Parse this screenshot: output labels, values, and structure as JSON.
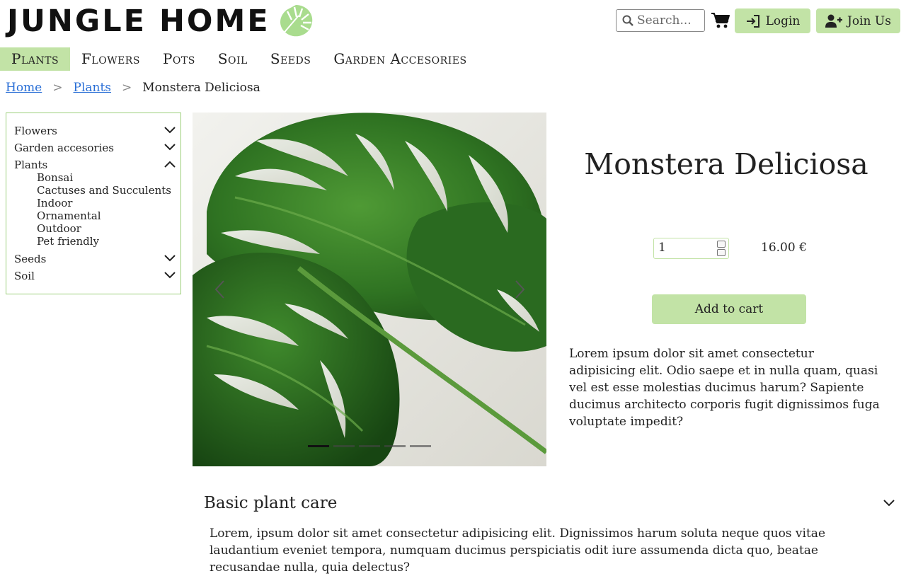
{
  "header": {
    "logo_text": "JUNGLE HOME",
    "search_placeholder": "Search...",
    "login_label": "Login",
    "join_label": "Join Us"
  },
  "nav": {
    "items": [
      "Plants",
      "Flowers",
      "Pots",
      "Soil",
      "Seeds",
      "Garden Accesories"
    ],
    "active": "Plants"
  },
  "breadcrumb": {
    "home": "Home",
    "plants": "Plants",
    "current": "Monstera Deliciosa",
    "separator": ">"
  },
  "sidebar": {
    "categories": [
      {
        "label": "Flowers",
        "expanded": false
      },
      {
        "label": "Garden accesories",
        "expanded": false
      },
      {
        "label": "Plants",
        "expanded": true,
        "children": [
          "Bonsai",
          "Cactuses and Succulents",
          "Indoor",
          "Ornamental",
          "Outdoor",
          "Pet friendly"
        ]
      },
      {
        "label": "Seeds",
        "expanded": false
      },
      {
        "label": "Soil",
        "expanded": false
      }
    ]
  },
  "gallery": {
    "slide_count": 5,
    "active_slide": 1
  },
  "product": {
    "title": "Monstera Deliciosa",
    "quantity": "1",
    "price": "16.00 €",
    "add_to_cart": "Add to cart",
    "description": "Lorem ipsum dolor sit amet consectetur adipisicing elit. Odio saepe et in nulla quam, quasi vel est esse molestias ducimus harum? Sapiente ducimus architecto corporis fugit dignissimos fuga voluptate impedit?"
  },
  "care": {
    "title": "Basic plant care",
    "text": "Lorem, ipsum dolor sit amet consectetur adipisicing elit. Dignissimos harum soluta neque quos vitae laudantium eveniet tempora, numquam ducimus perspiciatis odit iure assumenda dicta quo, beatae recusandae nulla, quia delectus?"
  },
  "colors": {
    "accent_green": "#c2e3a6",
    "sidebar_border": "#9ccf7a",
    "link_blue": "#2a6fd6",
    "logo_leaf": "#a9dc8e"
  },
  "icons": [
    "search-icon",
    "cart-icon",
    "login-icon",
    "user-plus-icon",
    "monstera-leaf-logo-icon",
    "chevron-down-icon",
    "chevron-up-icon",
    "chevron-left-icon",
    "chevron-right-icon"
  ]
}
